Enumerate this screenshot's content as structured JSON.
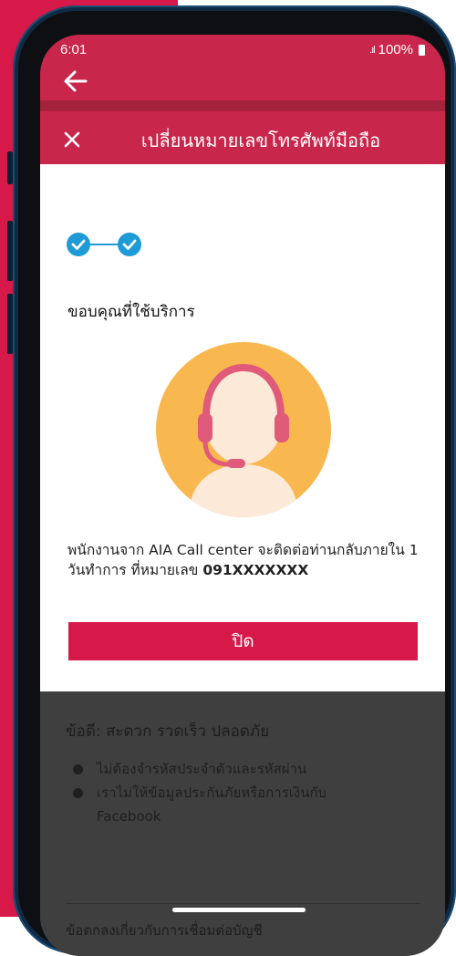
{
  "status_bar": {
    "time": "6:01",
    "signal": ".ıl",
    "battery": "100%"
  },
  "sheet": {
    "title": "เปลี่ยนหมายเลขโทรศัพท์มือถือ",
    "thanks": "ขอบคุณที่ใช้บริการ",
    "message_prefix": "พนักงานจาก AIA Call center จะติดต่อท่านกลับภายใน 1 วันทำการ ที่หมายเลข",
    "phone_number": "091XXXXXXX",
    "close_button": "ปิด"
  },
  "background_content": {
    "benefits_title": "ข้อดี: สะดวก รวดเร็ว ปลอดภัย",
    "benefits": [
      "ไม่ต้องจำรหัสประจำตัวและรหัสผ่าน",
      "เราไม่ให้ข้อมูลประกันภัยหรือการเงินกับ Facebook"
    ],
    "partial_text": "ข้อตกลงเกี่ยวกับการเชื่อมต่อบัญชี"
  },
  "colors": {
    "brand_red": "#d7194a",
    "header_red": "#c8264a",
    "check_blue": "#1e9bd7",
    "avatar_bg": "#f9b84f",
    "headset_pink": "#e05a7a"
  }
}
